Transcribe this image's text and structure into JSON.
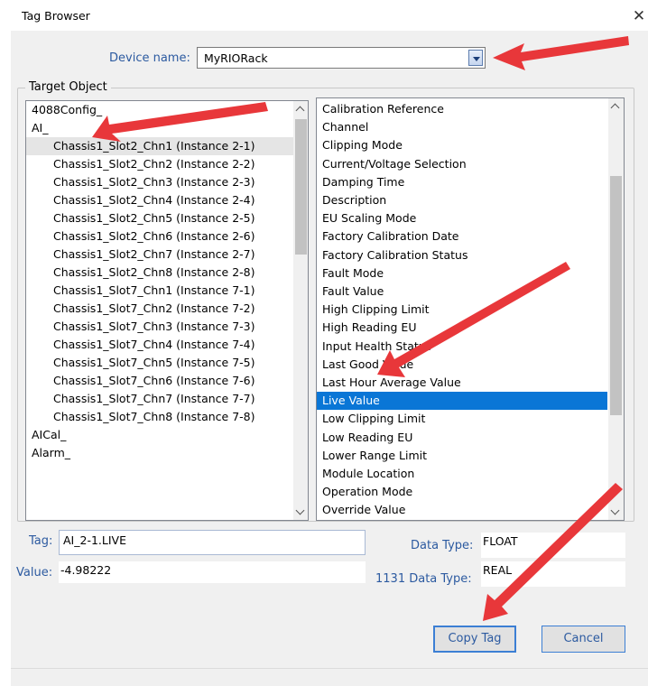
{
  "window": {
    "title": "Tag Browser",
    "close_glyph": "✕"
  },
  "device": {
    "label": "Device name:",
    "value": "MyRIORack"
  },
  "target_object": {
    "label": "Target Object",
    "objects": [
      {
        "label": "4088Config_",
        "level": "root"
      },
      {
        "label": "AI_",
        "level": "root"
      },
      {
        "label": "Chassis1_Slot2_Chn1 (Instance 2-1)",
        "level": "child",
        "selected": true
      },
      {
        "label": "Chassis1_Slot2_Chn2 (Instance 2-2)",
        "level": "child"
      },
      {
        "label": "Chassis1_Slot2_Chn3 (Instance 2-3)",
        "level": "child"
      },
      {
        "label": "Chassis1_Slot2_Chn4 (Instance 2-4)",
        "level": "child"
      },
      {
        "label": "Chassis1_Slot2_Chn5 (Instance 2-5)",
        "level": "child"
      },
      {
        "label": "Chassis1_Slot2_Chn6 (Instance 2-6)",
        "level": "child"
      },
      {
        "label": "Chassis1_Slot2_Chn7 (Instance 2-7)",
        "level": "child"
      },
      {
        "label": "Chassis1_Slot2_Chn8 (Instance 2-8)",
        "level": "child"
      },
      {
        "label": "Chassis1_Slot7_Chn1 (Instance 7-1)",
        "level": "child"
      },
      {
        "label": "Chassis1_Slot7_Chn2 (Instance 7-2)",
        "level": "child"
      },
      {
        "label": "Chassis1_Slot7_Chn3 (Instance 7-3)",
        "level": "child"
      },
      {
        "label": "Chassis1_Slot7_Chn4 (Instance 7-4)",
        "level": "child"
      },
      {
        "label": "Chassis1_Slot7_Chn5 (Instance 7-5)",
        "level": "child"
      },
      {
        "label": "Chassis1_Slot7_Chn6 (Instance 7-6)",
        "level": "child"
      },
      {
        "label": "Chassis1_Slot7_Chn7 (Instance 7-7)",
        "level": "child"
      },
      {
        "label": "Chassis1_Slot7_Chn8 (Instance 7-8)",
        "level": "child"
      },
      {
        "label": "AICal_",
        "level": "root"
      },
      {
        "label": "Alarm_",
        "level": "root"
      }
    ],
    "attributes": [
      {
        "label": "Calibration Reference"
      },
      {
        "label": "Channel"
      },
      {
        "label": "Clipping Mode"
      },
      {
        "label": "Current/Voltage Selection"
      },
      {
        "label": "Damping Time"
      },
      {
        "label": "Description"
      },
      {
        "label": "EU Scaling Mode"
      },
      {
        "label": "Factory Calibration Date"
      },
      {
        "label": "Factory Calibration Status"
      },
      {
        "label": "Fault Mode"
      },
      {
        "label": "Fault Value"
      },
      {
        "label": "High Clipping Limit"
      },
      {
        "label": "High Reading EU"
      },
      {
        "label": "Input Health Status"
      },
      {
        "label": "Last Good Value"
      },
      {
        "label": "Last Hour Average Value"
      },
      {
        "label": "Live Value",
        "selected": true
      },
      {
        "label": "Low Clipping Limit"
      },
      {
        "label": "Low Reading EU"
      },
      {
        "label": "Lower Range Limit"
      },
      {
        "label": "Module Location"
      },
      {
        "label": "Operation Mode"
      },
      {
        "label": "Override Value"
      }
    ]
  },
  "fields": {
    "tag_label": "Tag:",
    "tag_value": "AI_2-1.LIVE",
    "value_label": "Value:",
    "value_value": "-4.98222",
    "data_type_label": "Data Type:",
    "data_type_value": "FLOAT",
    "iec_type_label": "1131 Data Type:",
    "iec_type_value": "REAL"
  },
  "buttons": {
    "copy_tag": "Copy Tag",
    "cancel": "Cancel"
  },
  "colors": {
    "accent_text": "#2c5aa0",
    "selection": "#0a76d6",
    "annotation_arrow": "#e8373a"
  }
}
